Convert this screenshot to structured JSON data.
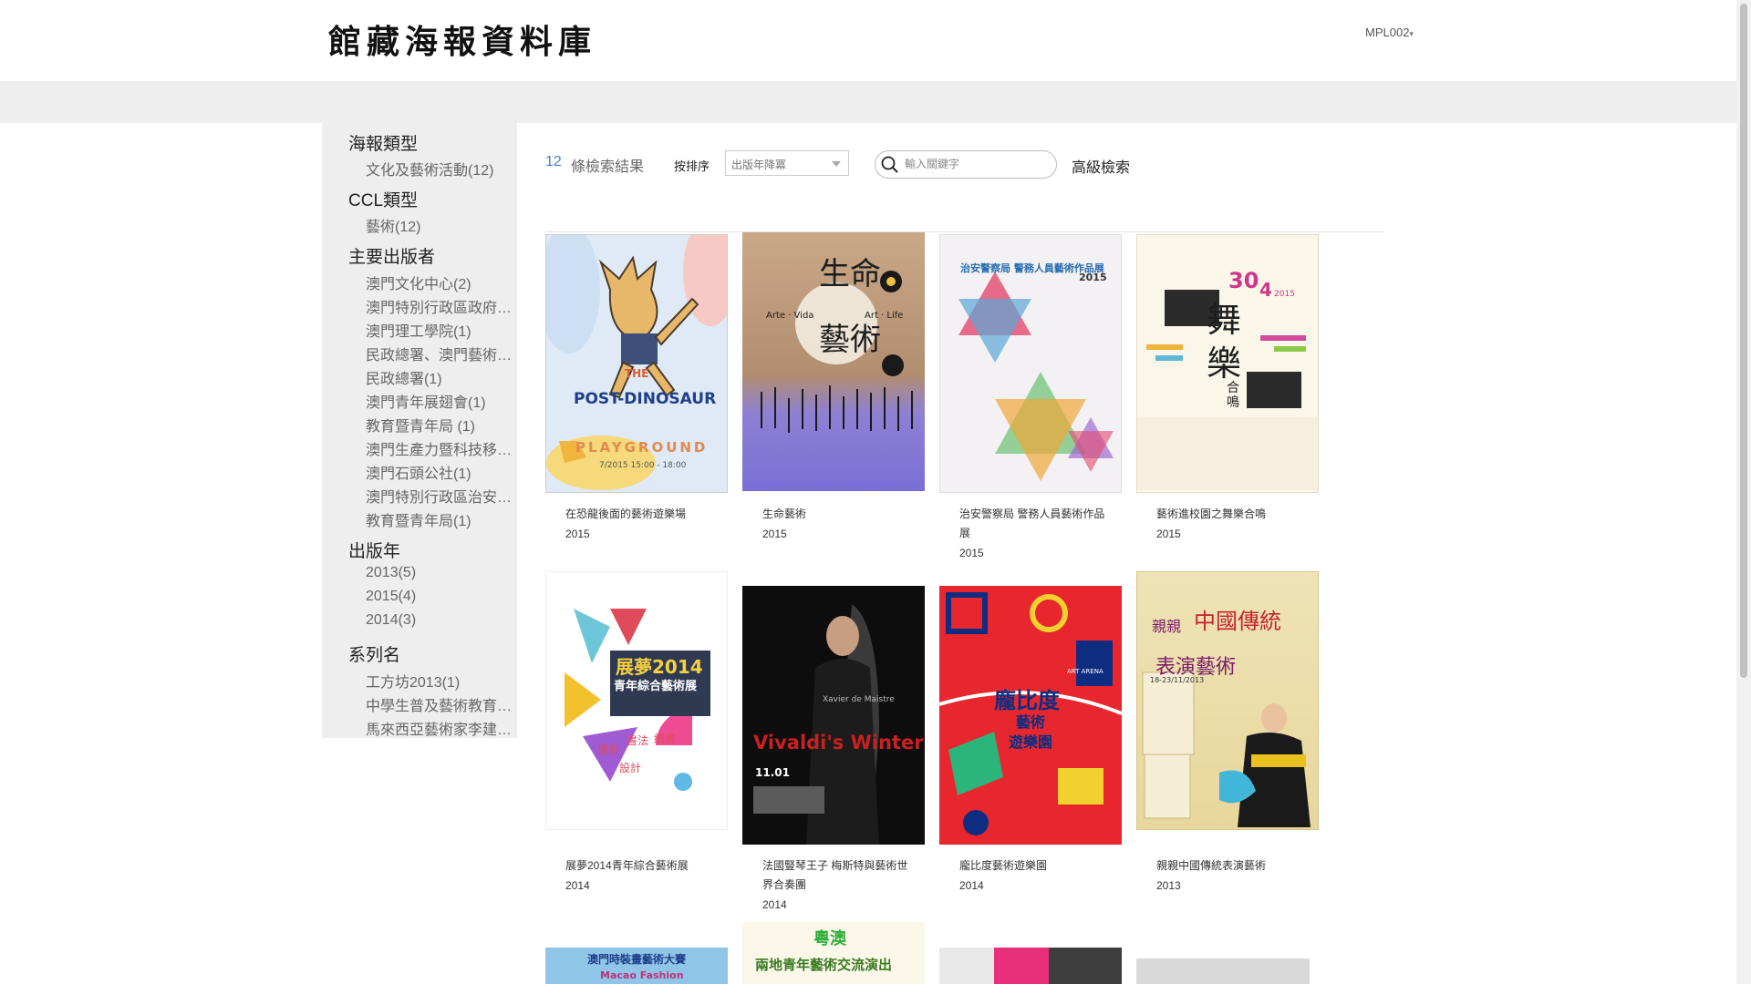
{
  "header": {
    "site_title": "館藏海報資料庫",
    "user_label": "MPL002",
    "user_caret": "▾"
  },
  "sidebar": {
    "groups": [
      {
        "label": "海報類型",
        "items": [
          "文化及藝術活動(12)"
        ]
      },
      {
        "label": "CCL類型",
        "items": [
          "藝術(12)"
        ]
      },
      {
        "label": "主要出版者",
        "items": [
          "澳門文化中心(2)",
          "澳門特別行政區政府…",
          "澳門理工學院(1)",
          "民政總署、澳門藝術…",
          "民政總署(1)",
          "澳門青年展翅會(1)",
          "教育暨青年局 (1)",
          "澳門生產力暨科技移…",
          "澳門石頭公社(1)",
          "澳門特別行政區治安…",
          "教育暨青年局(1)"
        ]
      },
      {
        "label": "出版年",
        "items": [
          "2013(5)",
          "2015(4)",
          "2014(3)"
        ]
      },
      {
        "label": "系列名",
        "items": [
          "工方坊2013(1)",
          "中學生普及藝術教育…",
          "馬來西亞藝術家李建…"
        ]
      }
    ]
  },
  "toolbar": {
    "count": "12",
    "count_label": "條檢索結果",
    "sort_label": "按排序",
    "sort_value": "出版年降冪",
    "search_placeholder": "輸入關鍵字",
    "advanced_label": "高級檢索"
  },
  "results": [
    {
      "title": "在恐龍後面的藝術遊樂場",
      "year": "2015",
      "poster_text": [
        "THE",
        "POST-DINOSAUR",
        "PLAYGROUND",
        "7/2015 15:00 - 18:00"
      ]
    },
    {
      "title": "生命藝術",
      "year": "2015",
      "poster_text": [
        "生命",
        "藝術",
        "Arte · Vida",
        "Art · Life"
      ]
    },
    {
      "title": "治安警察局 警務人員藝術作品展",
      "year": "2015",
      "poster_text": [
        "治安警察局 警務人員藝術作品展",
        "2015"
      ]
    },
    {
      "title": "藝術進校園之舞樂合鳴",
      "year": "2015",
      "poster_text": [
        "30",
        "4",
        "2015",
        "舞",
        "樂",
        "合鳴"
      ]
    },
    {
      "title": "展夢2014青年綜合藝術展",
      "year": "2014",
      "poster_text": [
        "展夢2014",
        "青年綜合藝術展",
        "攝影",
        "書法",
        "繪畫",
        "設計"
      ]
    },
    {
      "title": "法國豎琴王子 梅斯特與藝術世界合奏團",
      "year": "2014",
      "poster_text": [
        "Vivaldi's Winter",
        "Xavier de Maistre",
        "11.01"
      ]
    },
    {
      "title": "龐比度藝術遊樂園",
      "year": "2014",
      "poster_text": [
        "龐比度",
        "藝術",
        "遊樂園",
        "ART ARENA"
      ]
    },
    {
      "title": "親親中國傳統表演藝術",
      "year": "2013",
      "poster_text": [
        "親親",
        "中國傳統",
        "表演藝術",
        "18-23/11/2013"
      ]
    }
  ],
  "partial_posters": [
    "澳門時裝畫藝術大賽",
    "Macao Fashion",
    "兩地青年藝術交流演出",
    "粵澳"
  ],
  "colors": {
    "accent": "#4a7dc9",
    "band": "#eeeeee"
  }
}
